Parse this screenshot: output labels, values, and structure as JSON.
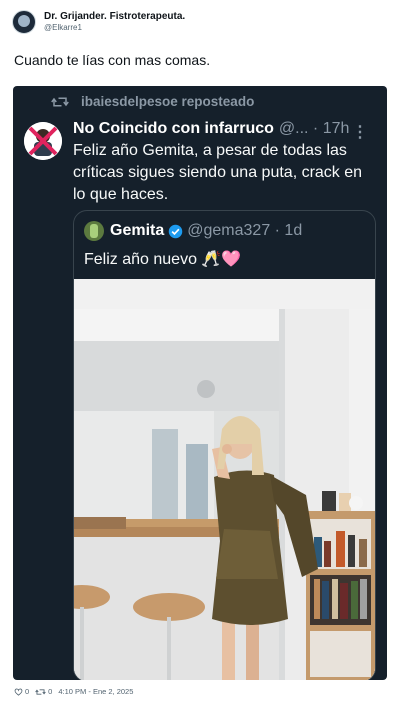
{
  "author": {
    "display_name": "Dr. Grijander. Fistroterapeuta.",
    "handle": "@Elkarre1"
  },
  "tweet": {
    "text": "Cuando te lías con mas comas."
  },
  "screenshot": {
    "repost_label": "ibaiesdelpesoe reposteado",
    "post": {
      "name": "No Coincido con infarruco",
      "handle_time": "@... · 17h",
      "body": "Feliz año Gemita, a pesar de todas las críticas sigues siendo una puta, crack en lo que haces."
    },
    "quote": {
      "name": "Gemita",
      "handle_time": "@gema327 · 1d",
      "text": "Feliz año nuevo 🥂🩷"
    }
  },
  "footer": {
    "likes": "0",
    "retweets": "0",
    "timestamp": "4:10 PM - Ene 2, 2025"
  },
  "colors": {
    "screenshot_bg": "#15202b",
    "muted": "#8b98a5",
    "verified": "#1d9bf0"
  },
  "icons": [
    "repost-icon",
    "more-icon",
    "verified-icon",
    "heart-icon",
    "retweet-icon"
  ]
}
